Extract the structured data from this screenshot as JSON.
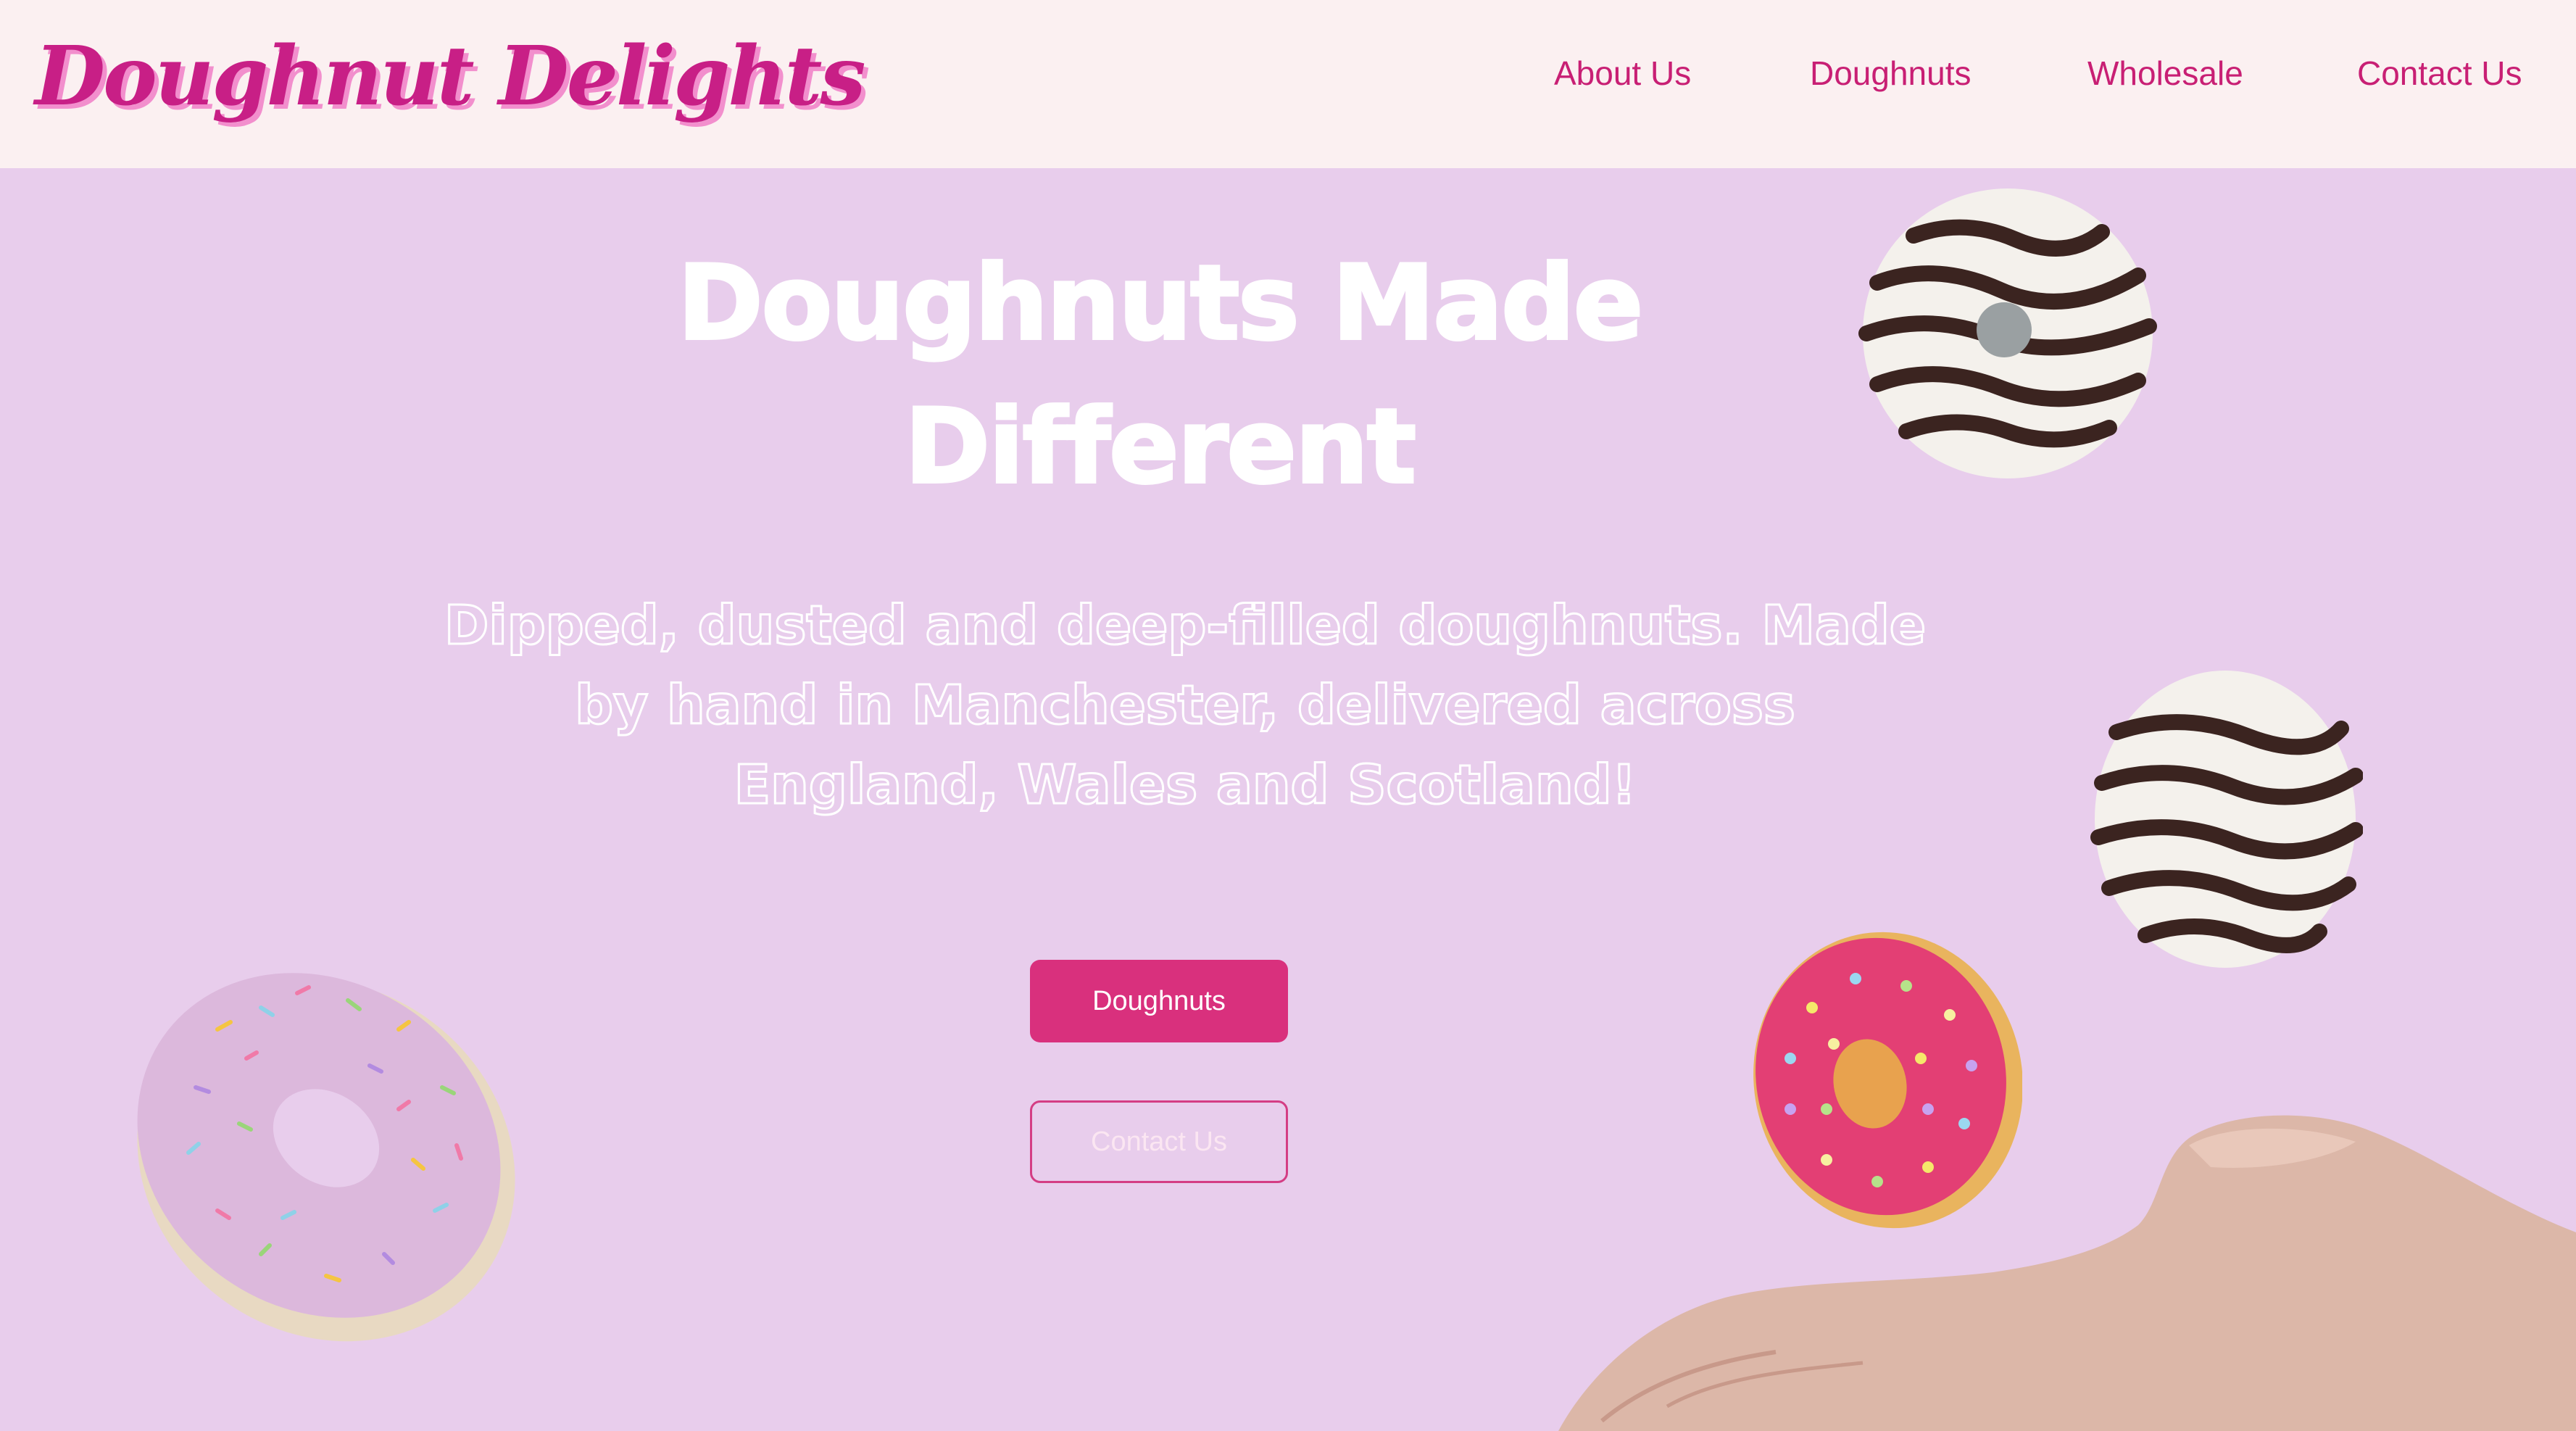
{
  "header": {
    "logo_text": "Doughnut Delights",
    "nav": {
      "about": "About Us",
      "doughnuts": "Doughnuts",
      "wholesale": "Wholesale",
      "contact": "Contact Us"
    }
  },
  "hero": {
    "title_line1": "Doughnuts Made",
    "title_line2": "Different",
    "subtitle_line1": "Dipped, dusted and deep-filled doughnuts. Made",
    "subtitle_line2": "by hand in Manchester, delivered across",
    "subtitle_line3": "England, Wales and Scotland!",
    "primary_button": "Doughnuts",
    "secondary_button": "Contact Us"
  },
  "colors": {
    "brand_pink": "#c81f86",
    "button_pink": "#d9307d",
    "hero_background": "#e8cdec",
    "header_background": "#fbf0f1"
  }
}
